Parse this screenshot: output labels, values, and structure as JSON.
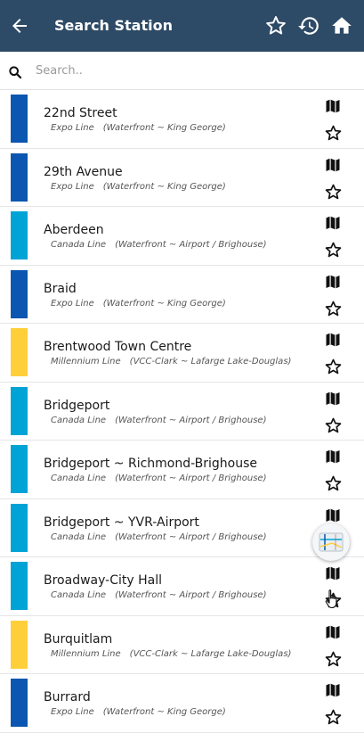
{
  "header": {
    "title": "Search Station",
    "back_icon": "arrow-back-icon",
    "favorites_icon": "star-outline-icon",
    "history_icon": "history-icon",
    "home_icon": "home-icon"
  },
  "search": {
    "placeholder": "Search..",
    "value": ""
  },
  "colors": {
    "header_bg": "#2d4a66",
    "expo_line": "#0b56b0",
    "canada_line": "#00a3d6",
    "millennium_line": "#ffcf3a"
  },
  "stations": [
    {
      "name": "22nd Street",
      "line": "Expo Line",
      "route": "(Waterfront ~ King George)",
      "color": "#0b56b0"
    },
    {
      "name": "29th Avenue",
      "line": "Expo Line",
      "route": "(Waterfront ~ King George)",
      "color": "#0b56b0"
    },
    {
      "name": "Aberdeen",
      "line": "Canada Line",
      "route": "(Waterfront ~ Airport / Brighouse)",
      "color": "#00a3d6"
    },
    {
      "name": "Braid",
      "line": "Expo Line",
      "route": "(Waterfront ~ King George)",
      "color": "#0b56b0"
    },
    {
      "name": "Brentwood Town Centre",
      "line": "Millennium Line",
      "route": "(VCC-Clark ~ Lafarge Lake-Douglas)",
      "color": "#ffcf3a"
    },
    {
      "name": "Bridgeport",
      "line": "Canada Line",
      "route": "(Waterfront ~ Airport / Brighouse)",
      "color": "#00a3d6"
    },
    {
      "name": "Bridgeport ~ Richmond-Brighouse",
      "line": "Canada Line",
      "route": "(Waterfront ~ Airport / Brighouse)",
      "color": "#00a3d6"
    },
    {
      "name": "Bridgeport ~ YVR-Airport",
      "line": "Canada Line",
      "route": "(Waterfront ~ Airport / Brighouse)",
      "color": "#00a3d6"
    },
    {
      "name": "Broadway-City Hall",
      "line": "Canada Line",
      "route": "(Waterfront ~ Airport / Brighouse)",
      "color": "#00a3d6"
    },
    {
      "name": "Burquitlam",
      "line": "Millennium Line",
      "route": "(VCC-Clark ~ Lafarge Lake-Douglas)",
      "color": "#ffcf3a"
    },
    {
      "name": "Burrard",
      "line": "Expo Line",
      "route": "(Waterfront ~ King George)",
      "color": "#0b56b0"
    }
  ],
  "row_icons": {
    "map": "map-icon",
    "favorite": "star-outline-icon"
  },
  "floating_button_icon": "transit-map-icon"
}
